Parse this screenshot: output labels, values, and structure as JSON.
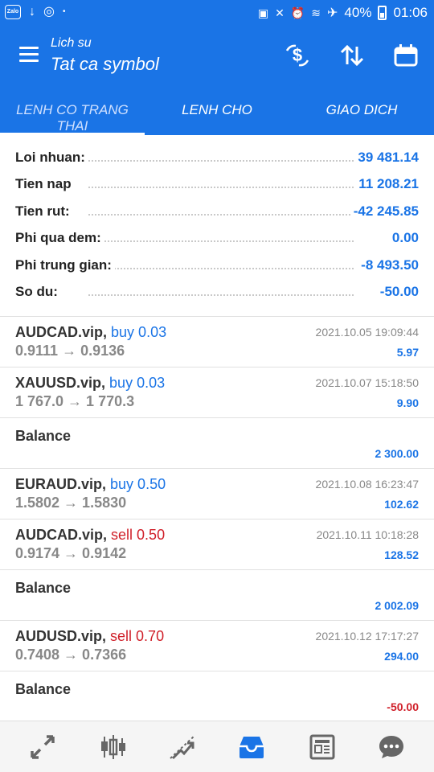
{
  "status_bar": {
    "app_badge": "Zalo",
    "battery": "40%",
    "time": "01:06"
  },
  "app_bar": {
    "subtitle": "Lich su",
    "title": "Tat ca symbol"
  },
  "tabs": [
    {
      "label": "LENH CO TRANG THAI",
      "active": true
    },
    {
      "label": "LENH CHO",
      "active": false
    },
    {
      "label": "GIAO DICH",
      "active": false
    }
  ],
  "summary": [
    {
      "label": "Loi nhuan:",
      "value": "39 481.14"
    },
    {
      "label": "Tien nap",
      "value": "11 208.21"
    },
    {
      "label": "Tien rut:",
      "value": "-42 245.85"
    },
    {
      "label": "Phi qua dem:",
      "value": "0.00"
    },
    {
      "label": "Phi trung gian:",
      "value": "-8 493.50"
    },
    {
      "label": "So du:",
      "value": "-50.00"
    }
  ],
  "items": [
    {
      "symbol": "AUDCAD.vip,",
      "side": "buy 0.03",
      "prices": "0.9111 → 0.9136",
      "datetime": "2021.10.05 19:09:44",
      "profit": "5.97"
    },
    {
      "symbol": "XAUUSD.vip,",
      "side": "buy 0.03",
      "prices": "1 767.0 → 1 770.3",
      "datetime": "2021.10.07 15:18:50",
      "profit": "9.90"
    },
    {
      "label": "Balance",
      "amount": "2 300.00"
    },
    {
      "symbol": "EURAUD.vip,",
      "side": "buy 0.50",
      "prices": "1.5802 → 1.5830",
      "datetime": "2021.10.08 16:23:47",
      "profit": "102.62"
    },
    {
      "symbol": "AUDCAD.vip,",
      "side": "sell 0.50",
      "prices": "0.9174 → 0.9142",
      "datetime": "2021.10.11 10:18:28",
      "profit": "128.52"
    },
    {
      "label": "Balance",
      "amount": "2 002.09"
    },
    {
      "symbol": "AUDUSD.vip,",
      "side": "sell 0.70",
      "prices": "0.7408 → 0.7366",
      "datetime": "2021.10.12 17:17:27",
      "profit": "294.00"
    },
    {
      "label": "Balance",
      "amount": "-50.00"
    }
  ],
  "bottom_nav": [
    {
      "icon": "quotes-arrows-icon",
      "active": false
    },
    {
      "icon": "candlestick-chart-icon",
      "active": false
    },
    {
      "icon": "trade-trend-icon",
      "active": false
    },
    {
      "icon": "history-inbox-icon",
      "active": true
    },
    {
      "icon": "news-icon",
      "active": false
    },
    {
      "icon": "chat-icon",
      "active": false
    }
  ],
  "colors": {
    "primary": "#1a74e6",
    "buy": "#1a74e6",
    "sell": "#d0202a",
    "muted": "#888888"
  }
}
